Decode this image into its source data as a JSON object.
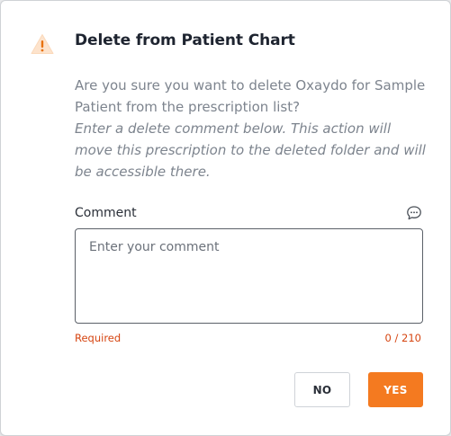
{
  "dialog": {
    "title": "Delete from Patient Chart",
    "question": "Are you sure you want to delete Oxaydo for Sample Patient from the prescription list?",
    "instruction": "Enter a delete comment below. This action will move this prescription to the deleted folder and will be accessible there.",
    "icon": "warning-icon"
  },
  "comment": {
    "label": "Comment",
    "placeholder": "Enter your comment",
    "value": "",
    "required_text": "Required",
    "counter": "0 / 210",
    "icon": "comment-bubble-icon"
  },
  "buttons": {
    "no_label": "NO",
    "yes_label": "YES"
  },
  "colors": {
    "accent": "#f47a20",
    "warning_bg": "#fde8d4",
    "error": "#d64511"
  }
}
